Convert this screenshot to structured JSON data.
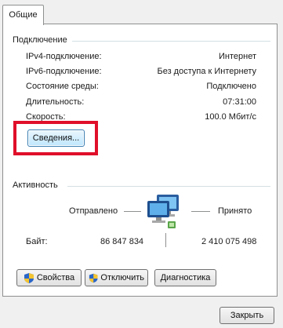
{
  "tab": {
    "label": "Общие"
  },
  "connection": {
    "title": "Подключение",
    "rows": [
      {
        "label": "IPv4-подключение:",
        "value": "Интернет"
      },
      {
        "label": "IPv6-подключение:",
        "value": "Без доступа к Интернету"
      },
      {
        "label": "Состояние среды:",
        "value": "Подключено"
      },
      {
        "label": "Длительность:",
        "value": "07:31:00"
      },
      {
        "label": "Скорость:",
        "value": "100.0 Мбит/с"
      }
    ],
    "details_button": "Сведения..."
  },
  "activity": {
    "title": "Активность",
    "sent_label": "Отправлено",
    "received_label": "Принято",
    "bytes_label": "Байт:",
    "bytes_sent": "86 847 834",
    "bytes_received": "2 410 075 498"
  },
  "buttons": {
    "properties": "Свойства",
    "disable": "Отключить",
    "diagnose": "Диагностика",
    "close": "Закрыть"
  },
  "colors": {
    "highlight_box": "#e00f2a"
  }
}
